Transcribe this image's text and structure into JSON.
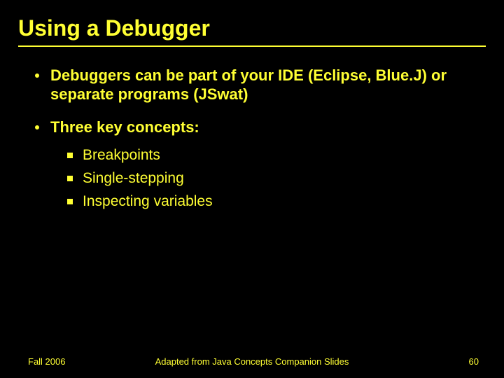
{
  "title": "Using a Debugger",
  "bullets": [
    {
      "text": "Debuggers can be part of your IDE (Eclipse, Blue.J) or separate programs (JSwat)"
    },
    {
      "text": "Three key concepts:"
    }
  ],
  "subbullets": [
    {
      "text": "Breakpoints"
    },
    {
      "text": "Single-stepping"
    },
    {
      "text": "Inspecting variables"
    }
  ],
  "footer": {
    "left": "Fall 2006",
    "center": "Adapted from Java Concepts Companion Slides",
    "right": "60"
  }
}
